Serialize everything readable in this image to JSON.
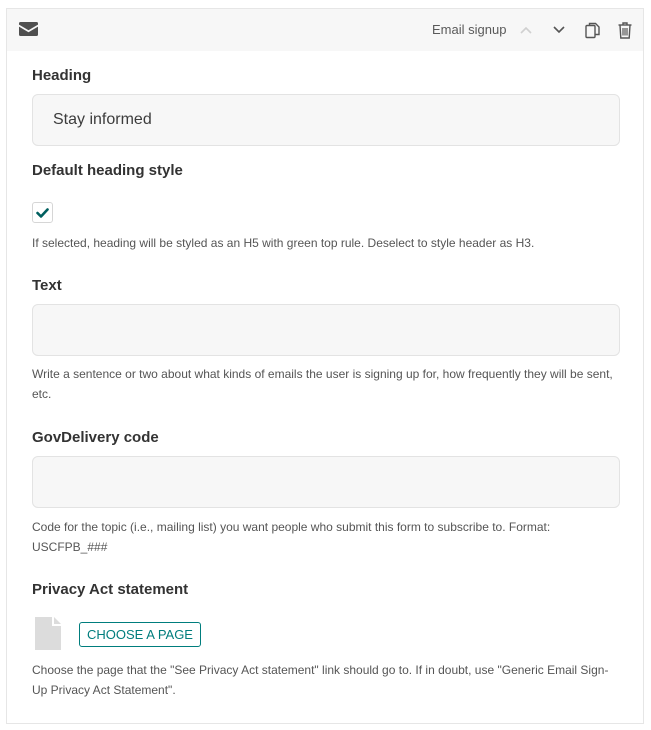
{
  "block": {
    "type_label": "Email signup",
    "icon": "mail-icon",
    "actions": [
      "chevron-up-icon",
      "chevron-down-icon",
      "copy-icon",
      "trash-icon"
    ]
  },
  "fields": {
    "heading": {
      "label": "Heading",
      "value": "Stay informed"
    },
    "default_heading_style": {
      "label": "Default heading style",
      "checked": true,
      "help": "If selected, heading will be styled as an H5 with green top rule. Deselect to style header as H3."
    },
    "text": {
      "label": "Text",
      "value": "",
      "help": "Write a sentence or two about what kinds of emails the user is signing up for, how frequently they will be sent, etc."
    },
    "gov_delivery_code": {
      "label": "GovDelivery code",
      "value": "",
      "help": "Code for the topic (i.e., mailing list) you want people who submit this form to subscribe to. Format: USCFPB_###"
    },
    "privacy_act": {
      "label": "Privacy Act statement",
      "button_label": "CHOOSE A PAGE",
      "help": "Choose the page that the \"See Privacy Act statement\" link should go to. If in doubt, use \"Generic Email Sign-Up Privacy Act Statement\"."
    }
  },
  "colors": {
    "accent": "#007d7d",
    "check": "#005f5f",
    "header_bg": "#f7f7f7",
    "input_bg": "#f7f7f7"
  }
}
